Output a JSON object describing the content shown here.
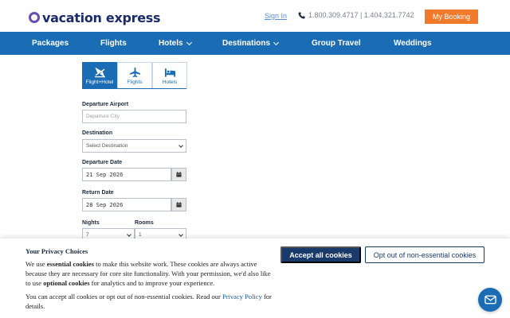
{
  "header": {
    "logo_text": "vacation express",
    "sign_in": "Sign In",
    "phone": "1.800.309.4717 | 1.404.321.7742",
    "my_booking": "My Booking"
  },
  "nav": {
    "items": [
      {
        "label": "Packages",
        "dropdown": false
      },
      {
        "label": "Flights",
        "dropdown": false
      },
      {
        "label": "Hotels",
        "dropdown": true
      },
      {
        "label": "Destinations",
        "dropdown": true
      },
      {
        "label": "Group Travel",
        "dropdown": false
      },
      {
        "label": "Weddings",
        "dropdown": false
      }
    ]
  },
  "search": {
    "tabs": [
      {
        "label": "Flight+Hotel",
        "icon": "flight-hotel-icon",
        "active": true
      },
      {
        "label": "Flights",
        "icon": "plane-icon",
        "active": false
      },
      {
        "label": "Hotels",
        "icon": "bed-icon",
        "active": false
      }
    ],
    "departure_airport": {
      "label": "Departure Airport",
      "placeholder": "Departure City"
    },
    "destination": {
      "label": "Destination",
      "value": "Select Destination"
    },
    "departure_date": {
      "label": "Departure Date",
      "value": "21 Sep 2026"
    },
    "return_date": {
      "label": "Return Date",
      "value": "28 Sep 2026"
    },
    "nights": {
      "label": "Nights",
      "value": "7"
    },
    "rooms": {
      "label": "Rooms",
      "value": "1"
    }
  },
  "cookie": {
    "title": "Your Privacy Choices",
    "p1_a": "We use ",
    "p1_b": "essential cookies",
    "p1_c": " to make this website work. These cookies are always active because they are necessary for core site functionality. With your permission, we'd also like to use ",
    "p1_d": "optional cookies",
    "p1_e": " for analytics and to improve your experience.",
    "p2_a": "You can accept all cookies or opt out of non-essential cookies. Read our ",
    "p2_link": "Privacy Policy",
    "p2_b": " for details.",
    "accept": "Accept all cookies",
    "opt_out": "Opt out of non-essential cookies"
  },
  "colors": {
    "brand_blue": "#1a6cb5",
    "accent_orange": "#f07a2a",
    "dark_navy": "#1a3a6c"
  }
}
